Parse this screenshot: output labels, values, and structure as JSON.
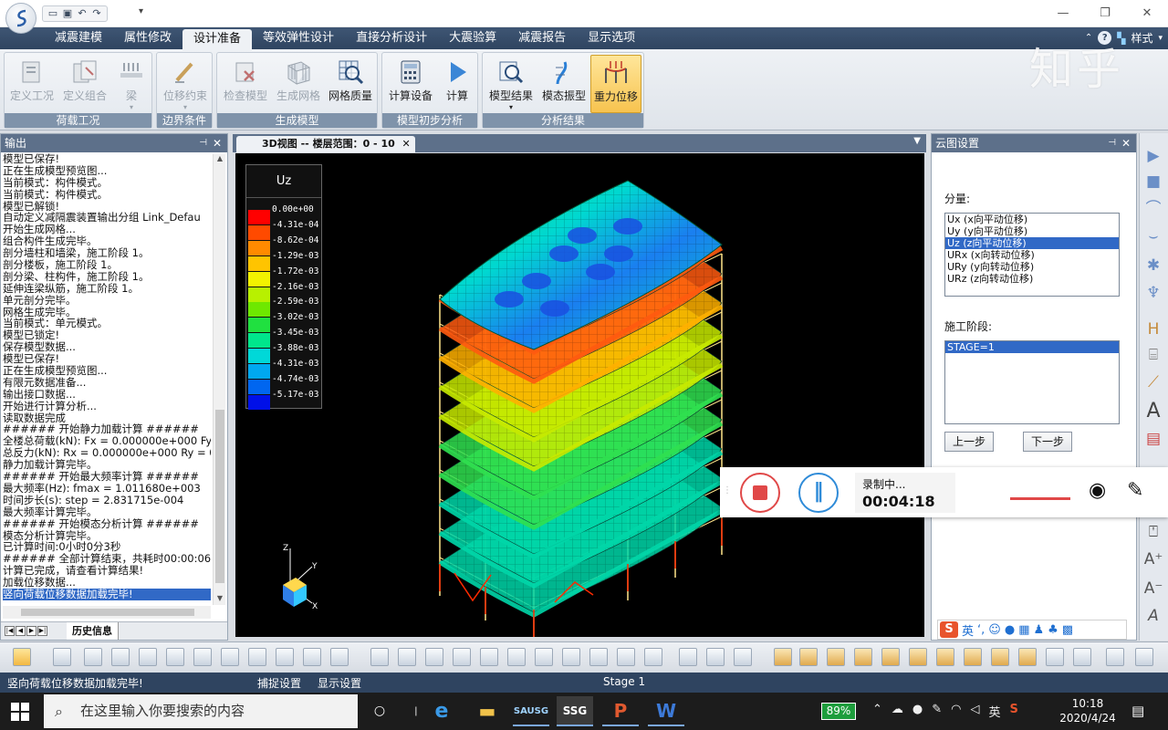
{
  "app": {
    "watermark": "知乎",
    "style_label": "样式",
    "ribbon_tabs": [
      "减震建模",
      "属性修改",
      "设计准备",
      "等效弹性设计",
      "直接分析设计",
      "大震验算",
      "减震报告",
      "显示选项"
    ],
    "active_tab": 2,
    "ribbon_groups": [
      {
        "label": "荷载工况",
        "buttons": [
          "定义工况",
          "定义组合",
          "梁"
        ]
      },
      {
        "label": "边界条件",
        "buttons": [
          "位移约束"
        ]
      },
      {
        "label": "生成模型",
        "buttons": [
          "检查模型",
          "生成网格",
          "网格质量"
        ]
      },
      {
        "label": "模型初步分析",
        "buttons": [
          "计算设备",
          "计算"
        ]
      },
      {
        "label": "分析结果",
        "buttons": [
          "模型结果",
          "模态振型",
          "重力位移"
        ]
      }
    ]
  },
  "output_panel": {
    "title": "输出",
    "lines": [
      "模型已保存!",
      "正在生成模型预览图...",
      "当前模式：构件模式。",
      "当前模式：构件模式。",
      "模型已解锁!",
      "自动定义减隔震装置输出分组 Link_Defau",
      "开始生成网格...",
      "组合构件生成完毕。",
      "剖分墙柱和墙梁，施工阶段 1。",
      "剖分楼板，施工阶段 1。",
      "剖分梁、柱构件，施工阶段 1。",
      "延伸连梁纵筋，施工阶段 1。",
      "单元剖分完毕。",
      "网格生成完毕。",
      "当前模式：单元模式。",
      "模型已锁定!",
      "保存模型数据...",
      "模型已保存!",
      "正在生成模型预览图...",
      "有限元数据准备...",
      "输出接口数据...",
      "开始进行计算分析...",
      "读取数据完成",
      "###### 开始静力加载计算 ######",
      "全楼总荷载(kN): Fx = 0.000000e+000  Fy = 0",
      "总反力(kN): Rx = 0.000000e+000  Ry = 0.000",
      "静力加载计算完毕。",
      "###### 开始最大频率计算 ######",
      "最大频率(Hz): fmax = 1.011680e+003",
      "时间步长(s): step = 2.831715e-004",
      "最大频率计算完毕。",
      "###### 开始模态分析计算 ######",
      "模态分析计算完毕。",
      "已计算时间:0小时0分3秒",
      "###### 全部计算结束，共耗时00:00:06 #",
      "计算已完成，请查看计算结果!",
      "加载位移数据...",
      "竖向荷载位移数据加载完毕!"
    ],
    "selected_line": 37,
    "bottom_tab": "历史信息"
  },
  "view": {
    "tab_title": "3D视图 -- 楼层范围：0 - 10",
    "legend_title": "Uz",
    "legend_levels": [
      "0.00e+00",
      "-4.31e-04",
      "-8.62e-04",
      "-1.29e-03",
      "-1.72e-03",
      "-2.16e-03",
      "-2.59e-03",
      "-3.02e-03",
      "-3.45e-03",
      "-3.88e-03",
      "-4.31e-03",
      "-4.74e-03",
      "-5.17e-03"
    ],
    "legend_colors": [
      "#ff0000",
      "#ff4a00",
      "#ff8a00",
      "#ffc400",
      "#f2f200",
      "#b8f000",
      "#6ee800",
      "#20e040",
      "#00e68c",
      "#00d8d8",
      "#00a8f0",
      "#0066f0",
      "#0010e8"
    ],
    "axis_labels": {
      "z": "Z",
      "y": "Y",
      "x": "X"
    }
  },
  "cloud_panel": {
    "title": "云图设置",
    "component_label": "分量:",
    "components": [
      "Ux (x向平动位移)",
      "Uy (y向平动位移)",
      "Uz (z向平动位移)",
      "URx (x向转动位移)",
      "URy (y向转动位移)",
      "URz (z向转动位移)"
    ],
    "selected_component": 2,
    "stage_label": "施工阶段:",
    "stages": [
      "STAGE=1"
    ],
    "prev_button": "上一步",
    "next_button": "下一步"
  },
  "recorder": {
    "status": "录制中...",
    "time": "00:04:18"
  },
  "ime": {
    "lang": "英"
  },
  "status_bar": {
    "message": "竖向荷载位移数据加载完毕!",
    "snap": "捕捉设置",
    "display": "显示设置",
    "stage": "Stage 1"
  },
  "taskbar": {
    "search_placeholder": "在这里输入你要搜索的内容",
    "apps": [
      "SAUSG",
      "SSG"
    ],
    "battery": "89%",
    "ime_tray": "英",
    "time": "10:18",
    "date": "2020/4/24"
  }
}
